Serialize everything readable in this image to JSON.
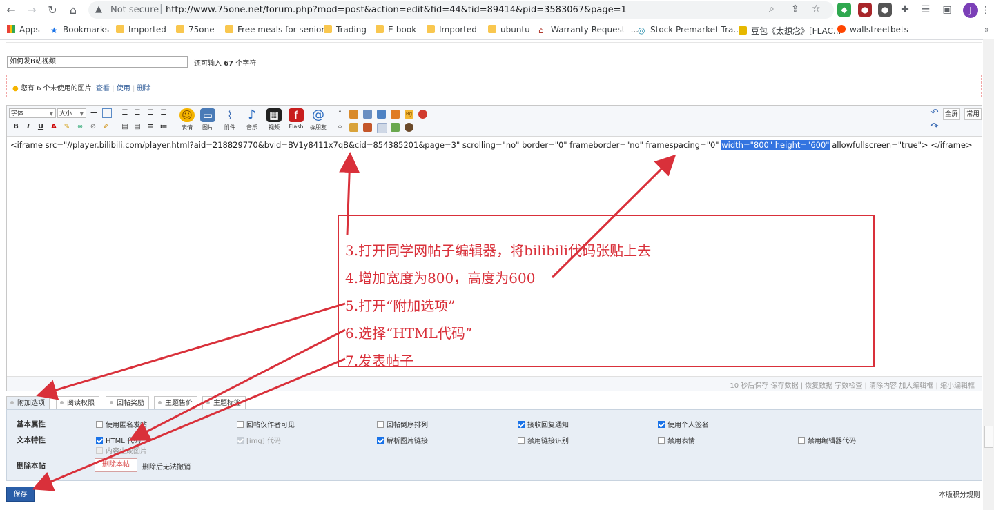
{
  "browser": {
    "security_label": "Not secure",
    "url": "http://www.75one.net/forum.php?mod=post&action=edit&fid=44&tid=89414&pid=3583067&page=1",
    "avatar_letter": "J",
    "bookmarks": [
      {
        "label": "Apps"
      },
      {
        "label": "Bookmarks"
      },
      {
        "label": "Imported"
      },
      {
        "label": "75one"
      },
      {
        "label": "Free meals for senior"
      },
      {
        "label": "Trading"
      },
      {
        "label": "E-book"
      },
      {
        "label": "Imported"
      },
      {
        "label": "ubuntu"
      },
      {
        "label": "Warranty Request -..."
      },
      {
        "label": "Stock Premarket Tra..."
      },
      {
        "label": "豆包《太想念》[FLAC..."
      },
      {
        "label": "wallstreetbets"
      }
    ],
    "overflow": "»"
  },
  "post": {
    "subject_value": "如何发B站视频",
    "counter_prefix": "还可输入",
    "counter_num": "67",
    "counter_suffix": "个字符"
  },
  "notice": {
    "text": "您有 6 个未使用的图片",
    "view": "查看",
    "use": "使用",
    "delete": "删除"
  },
  "editor": {
    "font_select": "字体",
    "size_select": "大小",
    "buttons": {
      "emoji": "表情",
      "image": "图片",
      "attach": "附件",
      "music": "音乐",
      "video": "视频",
      "flash": "Flash",
      "at": "@朋友"
    },
    "fullscreen": "全屏",
    "common": "常用",
    "code_before": "<iframe src=\"//player.bilibili.com/player.html?aid=218829770&bvid=BV1y8411x7qB&cid=854385201&page=3\" scrolling=\"no\" border=\"0\" frameborder=\"no\" framespacing=\"0\" ",
    "code_highlight": "width=\"800\" height=\"600\"",
    "code_after": " allowfullscreen=\"true\"> </iframe>",
    "status": "10 秒后保存 保存数据 | 恢复数据    字数检查 | 清除内容    加大编辑框 | 缩小编辑框"
  },
  "annotation": {
    "steps": [
      "3.打开同学网帖子编辑器，将bilibili代码张贴上去",
      "4.增加宽度为800，高度为600",
      "5.打开“附加选项”",
      "6.选择“HTML代码”",
      "7.发表帖子"
    ]
  },
  "tabs": [
    "附加选项",
    "阅读权限",
    "回帖奖励",
    "主题售价",
    "主题标签"
  ],
  "options": {
    "basic_label": "基本属性",
    "text_label": "文本特性",
    "delete_label": "删除本帖",
    "basic": [
      {
        "label": "使用匿名发帖",
        "checked": false
      },
      {
        "label": "回帖仅作者可见",
        "checked": false
      },
      {
        "label": "回帖倒序排列",
        "checked": false
      },
      {
        "label": "接收回复通知",
        "checked": true
      },
      {
        "label": "使用个人签名",
        "checked": true
      }
    ],
    "text": [
      {
        "label": "HTML 代码",
        "checked": true
      },
      {
        "label": "[img] 代码",
        "checked": true,
        "disabled": true
      },
      {
        "label": "解析图片链接",
        "checked": true
      },
      {
        "label": "禁用链接识别",
        "checked": false
      },
      {
        "label": "禁用表情",
        "checked": false
      },
      {
        "label": "禁用编辑器代码",
        "checked": false
      }
    ],
    "content_image": "内容生成图片",
    "delete_button": "删除本帖",
    "delete_tip": "删除后无法撤销"
  },
  "save_button": "保存",
  "rules_link": "本版积分规则"
}
